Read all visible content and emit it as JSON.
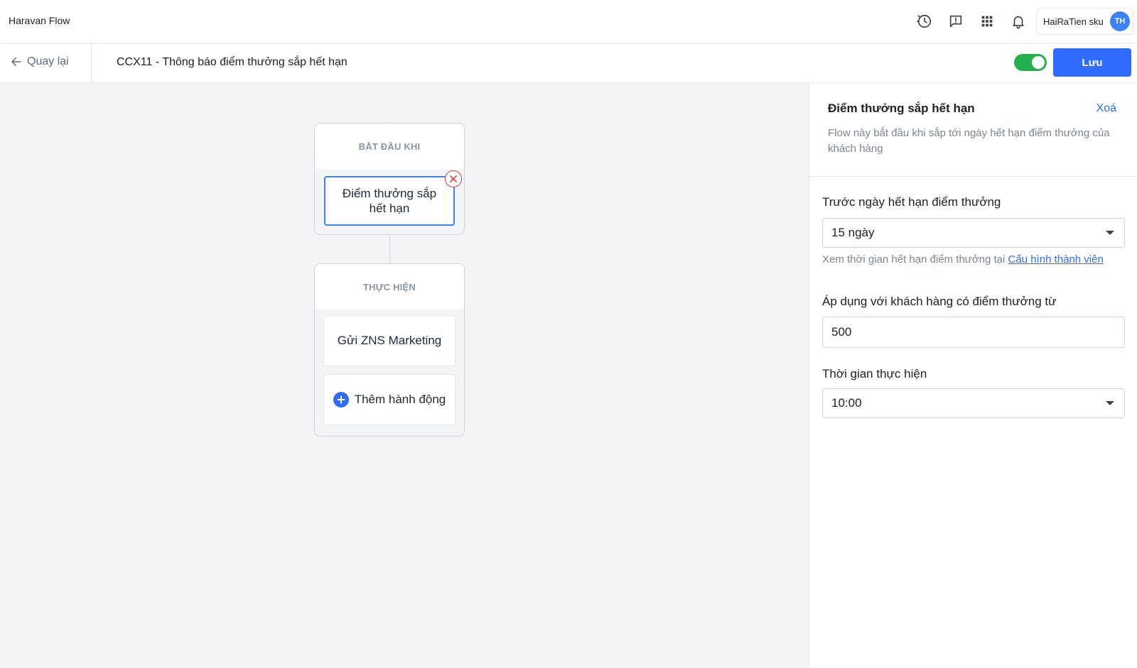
{
  "header": {
    "app_title": "Haravan Flow",
    "icons": [
      "history-icon",
      "feedback-icon",
      "apps-grid-icon",
      "notification-bell-icon"
    ],
    "user": {
      "name": "HaiRaTien sku",
      "initials": "TH",
      "avatar_color": "#3b82f6"
    }
  },
  "subheader": {
    "back_label": "Quay lại",
    "flow_name": "CCX11 - Thông báo điểm thưởng sắp hết hạn",
    "flow_enabled": true,
    "save_label": "Lưu",
    "toggle_color": "#22b14c",
    "save_color": "#2f6bff"
  },
  "canvas": {
    "trigger_section": {
      "heading": "BẮT ĐẦU KHI",
      "node_label": "Điểm thưởng sắp hết hạn"
    },
    "action_section": {
      "heading": "THỰC HIỆN",
      "action_label": "Gửi ZNS Marketing",
      "add_action_label": "Thêm hành động"
    }
  },
  "panel": {
    "title": "Điểm thưởng sắp hết hạn",
    "delete_label": "Xoá",
    "description": "Flow này bắt đầu khi sắp tới ngày hết hạn điểm thưởng của khách hàng",
    "fields": {
      "before_expiry": {
        "label": "Trước ngày hết hạn điểm thưởng",
        "value": "15 ngày",
        "hint_text": "Xem thời gian hết hạn điểm thưởng tại ",
        "hint_link": "Cấu hình thành viên"
      },
      "min_points": {
        "label": "Áp dụng với khách hàng có điểm thưởng từ",
        "value": "500"
      },
      "run_time": {
        "label": "Thời gian thực hiện",
        "value": "10:00"
      }
    }
  }
}
